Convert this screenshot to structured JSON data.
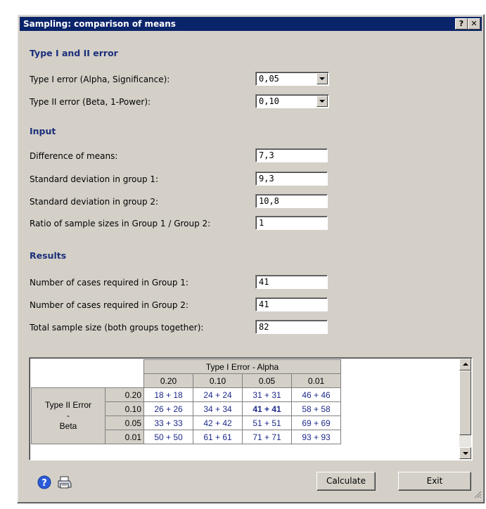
{
  "window": {
    "title": "Sampling: comparison of means",
    "help_button": "?",
    "close_button": "✕"
  },
  "error_section": {
    "heading": "Type I and II error",
    "alpha_label": "Type I error (Alpha, Significance):",
    "alpha_value": "0,05",
    "beta_label": "Type II error (Beta, 1-Power):",
    "beta_value": "0,10"
  },
  "input_section": {
    "heading": "Input",
    "diff_label": "Difference of means:",
    "diff_value": "7,3",
    "sd1_label": "Standard deviation in group 1:",
    "sd1_value": "9,3",
    "sd2_label": "Standard deviation in group 2:",
    "sd2_value": "10,8",
    "ratio_label": "Ratio of sample sizes in Group 1 / Group 2:",
    "ratio_value": "1"
  },
  "results_section": {
    "heading": "Results",
    "g1_label": "Number of cases required in Group 1:",
    "g1_value": "41",
    "g2_label": "Number of cases required in Group 2:",
    "g2_value": "41",
    "total_label": "Total sample size (both groups together):",
    "total_value": "82"
  },
  "table": {
    "alpha_header": "Type I Error - Alpha",
    "alpha_cols": [
      "0.20",
      "0.10",
      "0.05",
      "0.01"
    ],
    "beta_header_1": "Type II Error",
    "beta_header_2": "-",
    "beta_header_3": "Beta",
    "rows": [
      {
        "beta": "0.20",
        "cells": [
          "18 + 18",
          "24 + 24",
          "31 + 31",
          "46 + 46"
        ]
      },
      {
        "beta": "0.10",
        "cells": [
          "26 + 26",
          "34 + 34",
          "41 + 41",
          "58 + 58"
        ]
      },
      {
        "beta": "0.05",
        "cells": [
          "33 + 33",
          "42 + 42",
          "51 + 51",
          "69 + 69"
        ]
      },
      {
        "beta": "0.01",
        "cells": [
          "50 + 50",
          "61 + 61",
          "71 + 71",
          "93 + 93"
        ]
      }
    ]
  },
  "buttons": {
    "calculate": "Calculate",
    "exit": "Exit"
  },
  "icons": {
    "help": "help-icon",
    "print": "print-icon"
  }
}
